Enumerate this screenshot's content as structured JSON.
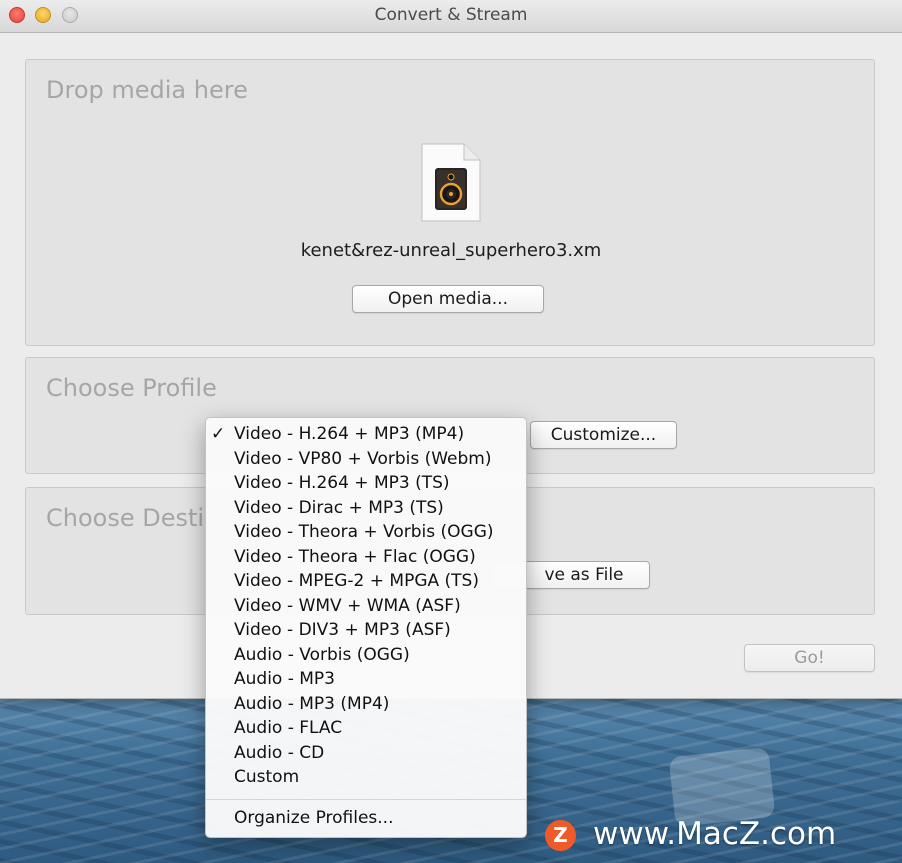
{
  "window": {
    "title": "Convert & Stream"
  },
  "drop_panel": {
    "label": "Drop media here",
    "filename": "kenet&rez-unreal_superhero3.xm",
    "open_button": "Open media..."
  },
  "profile_panel": {
    "label": "Choose Profile",
    "customize_button": "Customize..."
  },
  "destination_panel": {
    "label": "Choose Desti",
    "save_button": "ve as File"
  },
  "go_button": "Go!",
  "profile_menu": {
    "selected_index": 0,
    "check_mark": "✓",
    "items": [
      "Video - H.264 + MP3 (MP4)",
      "Video - VP80 + Vorbis (Webm)",
      "Video - H.264 + MP3 (TS)",
      "Video - Dirac + MP3 (TS)",
      "Video - Theora + Vorbis (OGG)",
      "Video - Theora + Flac (OGG)",
      "Video - MPEG-2 + MPGA (TS)",
      "Video - WMV + WMA (ASF)",
      "Video - DIV3 + MP3 (ASF)",
      "Audio - Vorbis (OGG)",
      "Audio - MP3",
      "Audio - MP3 (MP4)",
      "Audio - FLAC",
      "Audio - CD",
      "Custom"
    ],
    "organize": "Organize Profiles..."
  },
  "watermark": {
    "logo": "Z",
    "text": "www.MacZ.com"
  }
}
